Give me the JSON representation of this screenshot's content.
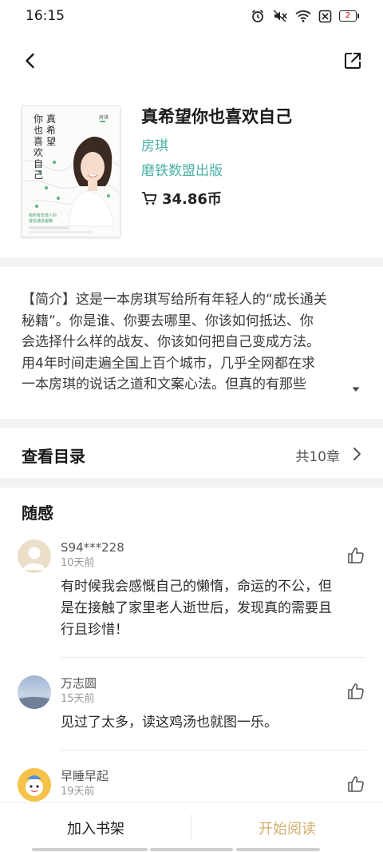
{
  "status_bar": {
    "time": "16:15",
    "battery_level": "2",
    "icons": [
      "alarm-icon",
      "mute-icon",
      "wifi-icon",
      "sim-disabled-icon",
      "battery-icon"
    ]
  },
  "nav": {
    "back_icon": "chevron-left-icon",
    "share_icon": "share-icon"
  },
  "book": {
    "title": "真希望你也喜欢自己",
    "author": "房琪",
    "publisher": "磨铁数盟出版",
    "price": "34.86币",
    "cart_icon": "cart-icon",
    "cover": {
      "title_col1": "真希望",
      "title_col2": "你也喜欢自己",
      "author_small": "房琪",
      "tagline_1": "给所有年轻人的",
      "tagline_2": "成长通关秘籍"
    }
  },
  "intro": {
    "lines": [
      "【简介】这是一本房琪写给所有年轻人的“成长通关",
      "秘籍”。你是谁、你要去哪里、你该如何抵达、你",
      "会选择什么样的战友、你该如何把自己变成方法。",
      "用4年时间走遍全国上百个城市，几乎全网都在求",
      "一本房琪的说话之道和文案心法。但真的有那些"
    ],
    "expand_icon": "triangle-down-icon"
  },
  "toc": {
    "label": "查看目录",
    "count": "共10章",
    "chevron_icon": "chevron-right-icon"
  },
  "notes": {
    "heading": "随感",
    "comments": [
      {
        "name": "S94***228",
        "time": "10天前",
        "body_lines": [
          "有时候我会感慨自己的懒惰，命运的不公，但",
          "是在接触了家里老人逝世后，发现真的需要且",
          "行且珍惜！"
        ],
        "avatar": "default-avatar-icon",
        "like_icon": "thumbs-up-icon"
      },
      {
        "name": "万志圆",
        "time": "15天前",
        "body_lines": [
          "见过了太多，读这鸡汤也就图一乐。"
        ],
        "avatar": "sky-avatar-icon",
        "like_icon": "thumbs-up-icon"
      },
      {
        "name": "早睡早起",
        "time": "19天前",
        "body_lines": [],
        "avatar": "cartoon-avatar-icon",
        "like_icon": "thumbs-up-icon"
      }
    ]
  },
  "bottom": {
    "shelf_label": "加入书架",
    "read_label": "开始阅读"
  },
  "colors": {
    "accent_teal": "#4cb2a4",
    "read_gold": "#d3ae6e",
    "band_gray": "#f3f3f3"
  }
}
